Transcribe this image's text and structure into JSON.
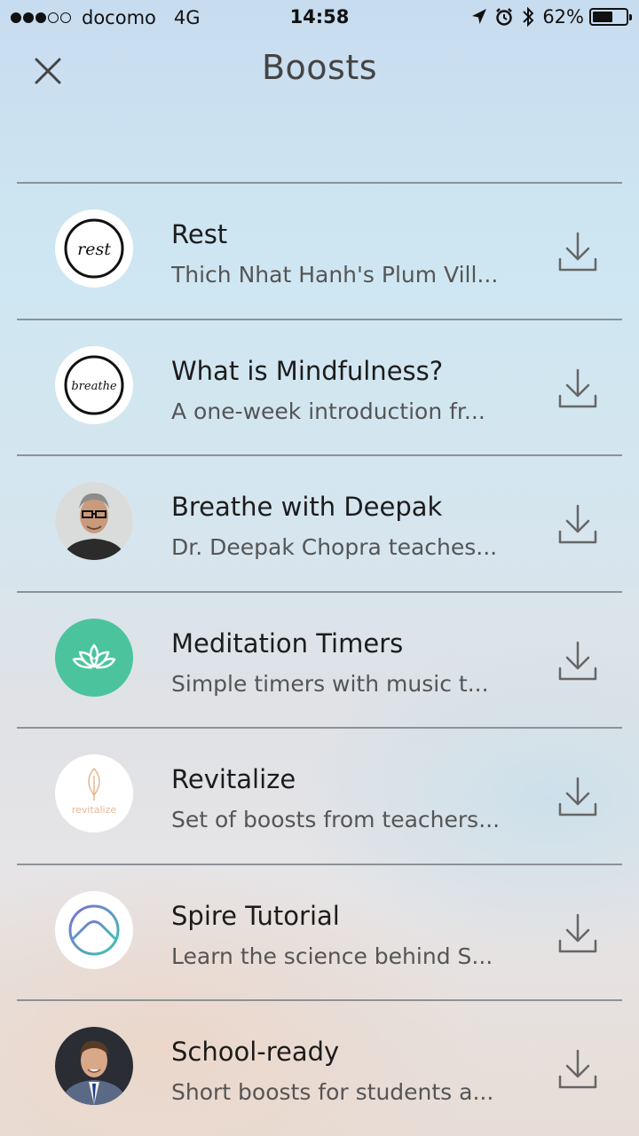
{
  "status": {
    "carrier": "docomo",
    "network": "4G",
    "time": "14:58",
    "battery": "62%",
    "battery_level": 0.62,
    "signal_bars_filled": 3,
    "signal_bars_total": 5
  },
  "header": {
    "title": "Boosts",
    "close_icon": "close-icon"
  },
  "colors": {
    "accent_green": "#4bc49d",
    "divider": "#8d9297"
  },
  "boosts": [
    {
      "title": "Rest",
      "subtitle": "Thich Nhat Hanh's Plum Vill...",
      "avatar_text": "rest",
      "icon": "download-icon"
    },
    {
      "title": "What is Mindfulness?",
      "subtitle": "A one-week introduction fr...",
      "avatar_text": "breathe",
      "icon": "download-icon"
    },
    {
      "title": "Breathe with Deepak",
      "subtitle": "Dr. Deepak Chopra teaches...",
      "icon": "download-icon"
    },
    {
      "title": "Meditation Timers",
      "subtitle": "Simple timers with music t...",
      "icon": "download-icon"
    },
    {
      "title": "Revitalize",
      "subtitle": "Set of boosts from teachers...",
      "avatar_text": "revitalize",
      "icon": "download-icon"
    },
    {
      "title": "Spire Tutorial",
      "subtitle": "Learn the science behind S...",
      "icon": "download-icon"
    },
    {
      "title": "School-ready",
      "subtitle": "Short boosts for students a...",
      "icon": "download-icon"
    }
  ]
}
